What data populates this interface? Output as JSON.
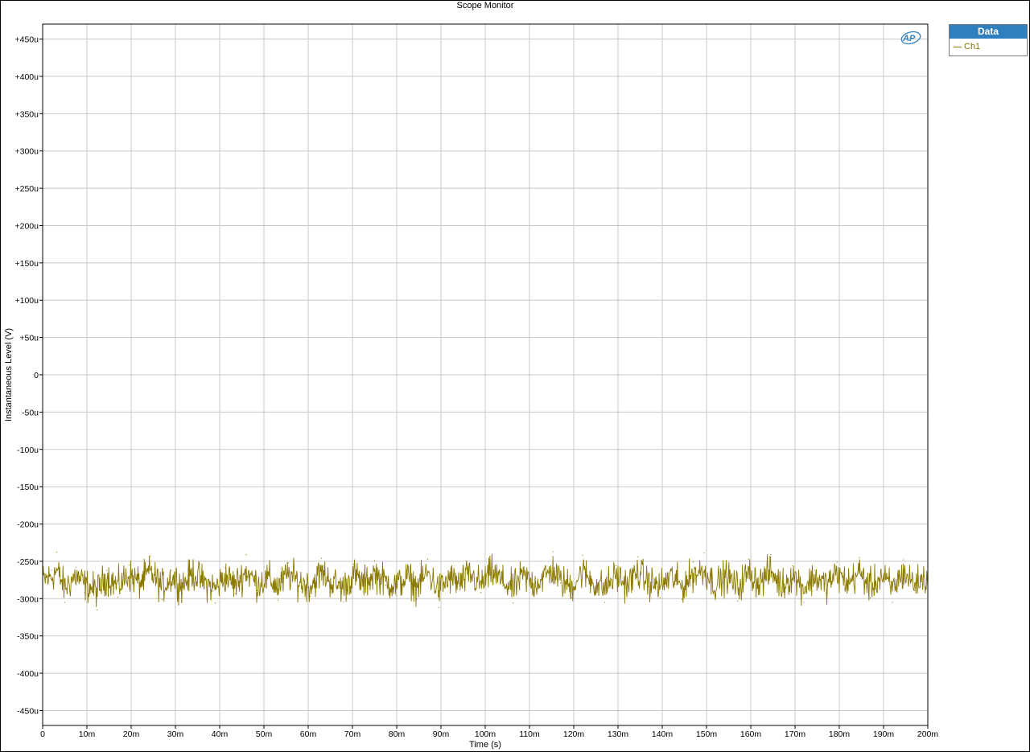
{
  "window": {
    "title": "Scope Monitor"
  },
  "legend": {
    "header": "Data",
    "items": [
      {
        "name": "Ch1",
        "color": "#8b7a00"
      }
    ]
  },
  "logo": {
    "text": "AP",
    "color": "#2e7fbf"
  },
  "chart_data": {
    "type": "line",
    "title": "Scope Monitor",
    "xlabel": "Time (s)",
    "ylabel": "Instantaneous Level (V)",
    "xlim": [
      0,
      0.2
    ],
    "ylim": [
      -0.00047,
      0.00047
    ],
    "grid": true,
    "legend_position": "right-outside-top",
    "x_ticks": [
      {
        "v": 0,
        "label": "0"
      },
      {
        "v": 0.01,
        "label": "10m"
      },
      {
        "v": 0.02,
        "label": "20m"
      },
      {
        "v": 0.03,
        "label": "30m"
      },
      {
        "v": 0.04,
        "label": "40m"
      },
      {
        "v": 0.05,
        "label": "50m"
      },
      {
        "v": 0.06,
        "label": "60m"
      },
      {
        "v": 0.07,
        "label": "70m"
      },
      {
        "v": 0.08,
        "label": "80m"
      },
      {
        "v": 0.09,
        "label": "90m"
      },
      {
        "v": 0.1,
        "label": "100m"
      },
      {
        "v": 0.11,
        "label": "110m"
      },
      {
        "v": 0.12,
        "label": "120m"
      },
      {
        "v": 0.13,
        "label": "130m"
      },
      {
        "v": 0.14,
        "label": "140m"
      },
      {
        "v": 0.15,
        "label": "150m"
      },
      {
        "v": 0.16,
        "label": "160m"
      },
      {
        "v": 0.17,
        "label": "170m"
      },
      {
        "v": 0.18,
        "label": "180m"
      },
      {
        "v": 0.19,
        "label": "190m"
      },
      {
        "v": 0.2,
        "label": "200m"
      }
    ],
    "y_ticks": [
      {
        "v": 0.00045,
        "label": "+450u"
      },
      {
        "v": 0.0004,
        "label": "+400u"
      },
      {
        "v": 0.00035,
        "label": "+350u"
      },
      {
        "v": 0.0003,
        "label": "+300u"
      },
      {
        "v": 0.00025,
        "label": "+250u"
      },
      {
        "v": 0.0002,
        "label": "+200u"
      },
      {
        "v": 0.00015,
        "label": "+150u"
      },
      {
        "v": 0.0001,
        "label": "+100u"
      },
      {
        "v": 5e-05,
        "label": "+50u"
      },
      {
        "v": 0,
        "label": "0"
      },
      {
        "v": -5e-05,
        "label": "-50u"
      },
      {
        "v": -0.0001,
        "label": "-100u"
      },
      {
        "v": -0.00015,
        "label": "-150u"
      },
      {
        "v": -0.0002,
        "label": "-200u"
      },
      {
        "v": -0.00025,
        "label": "-250u"
      },
      {
        "v": -0.0003,
        "label": "-300u"
      },
      {
        "v": -0.00035,
        "label": "-350u"
      },
      {
        "v": -0.0004,
        "label": "-400u"
      },
      {
        "v": -0.00045,
        "label": "-450u"
      }
    ],
    "series": [
      {
        "name": "Ch1",
        "color": "#8b7a00",
        "x": [
          0,
          0.002,
          0.0032,
          0.005,
          0.0075,
          0.0095,
          0.0123,
          0.0145,
          0.017,
          0.0195,
          0.022,
          0.0243,
          0.027,
          0.0292,
          0.0315,
          0.034,
          0.0365,
          0.039,
          0.0413,
          0.0435,
          0.046,
          0.0485,
          0.051,
          0.0532,
          0.0555,
          0.058,
          0.0605,
          0.063,
          0.0655,
          0.068,
          0.0703,
          0.0725,
          0.075,
          0.0775,
          0.08,
          0.0823,
          0.0845,
          0.087,
          0.0895,
          0.092,
          0.0943,
          0.0965,
          0.099,
          0.1015,
          0.104,
          0.1063,
          0.1085,
          0.111,
          0.1153,
          0.117,
          0.1195,
          0.122,
          0.1245,
          0.127,
          0.1295,
          0.132,
          0.1345,
          0.137,
          0.1395,
          0.142,
          0.1445,
          0.147,
          0.1495,
          0.152,
          0.1545,
          0.157,
          0.1595,
          0.162,
          0.1645,
          0.167,
          0.1695,
          0.172,
          0.1745,
          0.177,
          0.1795,
          0.182,
          0.1845,
          0.187,
          0.1895,
          0.192,
          0.1945,
          0.197,
          0.2
        ],
        "y": [
          -0.000275,
          -0.000262,
          -0.000238,
          -0.000305,
          -0.000258,
          -0.000292,
          -0.000315,
          -0.000262,
          -0.000298,
          -0.000255,
          -0.000287,
          -0.000243,
          -0.000301,
          -0.000262,
          -0.000294,
          -0.000248,
          -0.000285,
          -0.000306,
          -0.000259,
          -0.000293,
          -0.000241,
          -0.000289,
          -0.000268,
          -0.000302,
          -0.000252,
          -0.000283,
          -0.000297,
          -0.000246,
          -0.000286,
          -0.000304,
          -0.000254,
          -0.000291,
          -0.000249,
          -0.000282,
          -0.000296,
          -0.000262,
          -0.000301,
          -0.000247,
          -0.000312,
          -0.000268,
          -0.000288,
          -0.000253,
          -0.000292,
          -0.000243,
          -0.000283,
          -0.000306,
          -0.000259,
          -0.000291,
          -0.000237,
          -0.000279,
          -0.000299,
          -0.000242,
          -0.000286,
          -0.000305,
          -0.000256,
          -0.000293,
          -0.000244,
          -0.000284,
          -0.000299,
          -0.000261,
          -0.000301,
          -0.000251,
          -0.000239,
          -0.000294,
          -0.000258,
          -0.000303,
          -0.000247,
          -0.000286,
          -0.000241,
          -0.000297,
          -0.000256,
          -0.000305,
          -0.000262,
          -0.000293,
          -0.000251,
          -0.000287,
          -0.000245,
          -0.000299,
          -0.000262,
          -0.000305,
          -0.000248,
          -0.000289,
          -0.000263
        ]
      }
    ]
  }
}
